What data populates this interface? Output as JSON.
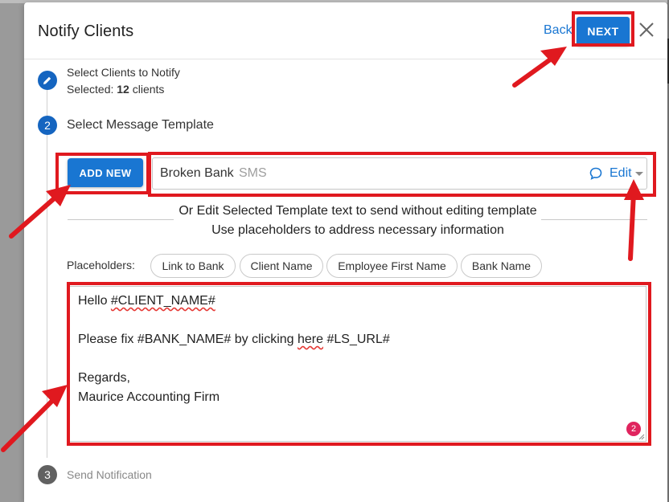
{
  "dialog": {
    "title": "Notify Clients",
    "back_label": "Back",
    "next_label": "NEXT"
  },
  "steps": {
    "step1": {
      "title": "Select Clients to Notify",
      "selected_prefix": "Selected:",
      "selected_count": "12",
      "selected_suffix": "clients"
    },
    "step2": {
      "number": "2",
      "title": "Select Message Template",
      "add_new_label": "ADD NEW",
      "template": {
        "name": "Broken Bank",
        "type": "SMS",
        "edit_label": "Edit"
      },
      "hint_line1": "Or Edit Selected Template text to send without editing template",
      "hint_line2": "Use placeholders to address necessary information",
      "placeholders_label": "Placeholders:",
      "placeholders": [
        "Link to Bank",
        "Client Name",
        "Employee First Name",
        "Bank Name"
      ],
      "message": {
        "line1_prefix": "Hello ",
        "line1_token": "#CLIENT_NAME#",
        "line2_prefix": "Please fix #BANK_NAME# by clicking ",
        "line2_word": "here",
        "line2_suffix": " #LS_URL#",
        "line3": "Regards,",
        "line4": "Maurice Accounting Firm"
      },
      "badge_count": "2"
    },
    "step3": {
      "number": "3",
      "title": "Send Notification"
    }
  },
  "colors": {
    "accent": "#1976d2",
    "highlight": "#e0191f",
    "step_active": "#1565c0",
    "step_inactive": "#616161",
    "badge": "#e0245e"
  }
}
